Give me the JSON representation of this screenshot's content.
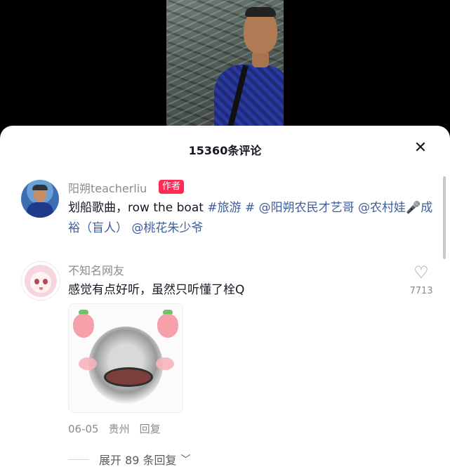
{
  "sheet": {
    "title": "15360条评论"
  },
  "comments": [
    {
      "username": "阳朔teacherliu",
      "author_tag": "作者",
      "text_plain": "划船歌曲，row the boat ",
      "tag1": "#旅游",
      "tag2": " # ",
      "mention1": "@阳朔农民才艺哥",
      "text_gap": " ",
      "mention2": "@农村娃🎤成裕（盲人）",
      "text_gap2": "  ",
      "mention3": "@桃花朱少爷"
    },
    {
      "username": "不知名网友",
      "text": "感觉有点好听，虽然只听懂了栓Q",
      "like_count": "7713",
      "date": "06-05",
      "location": "贵州",
      "reply_label": "回复",
      "expand_label": "展开 89 条回复"
    }
  ],
  "icons": {
    "close": "close-icon",
    "like": "heart-icon",
    "expand": "chevron-down-icon"
  }
}
